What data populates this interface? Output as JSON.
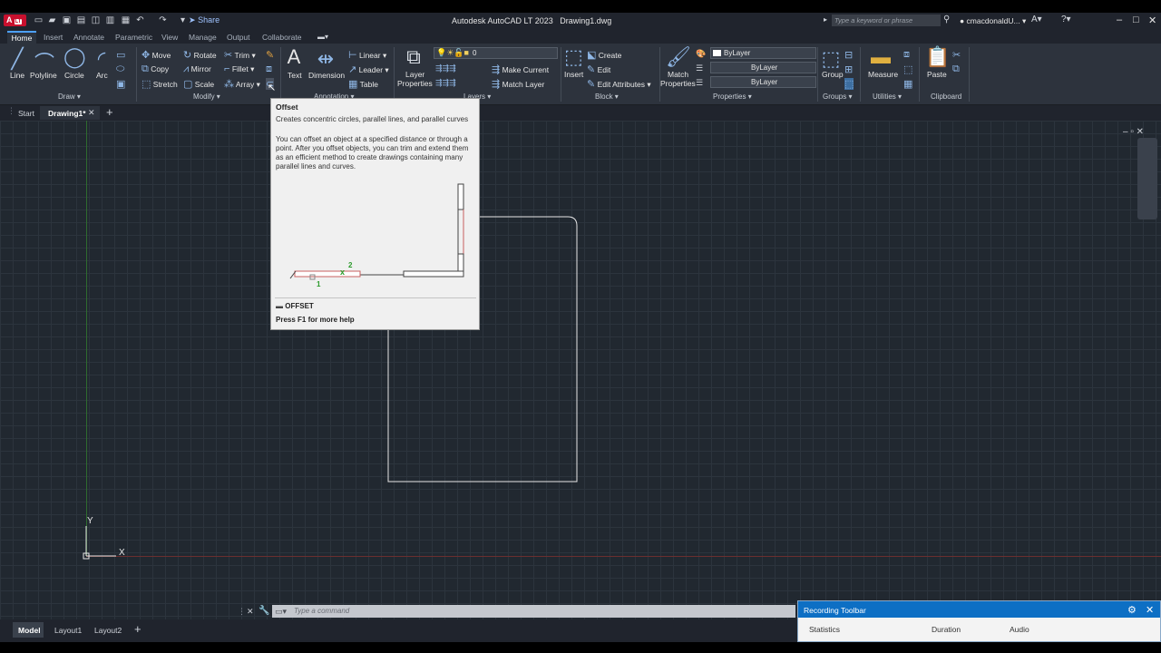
{
  "app": {
    "logo_text": "A",
    "logo_badge": "LT",
    "title": "Autodesk AutoCAD LT 2023",
    "document": "Drawing1.dwg",
    "share_label": "Share",
    "search_placeholder": "Type a keyword or phrase",
    "user": "cmacdonaldU..."
  },
  "ribbon_tabs": [
    "Home",
    "Insert",
    "Annotate",
    "Parametric",
    "View",
    "Manage",
    "Output",
    "Collaborate"
  ],
  "draw": {
    "panel": "Draw",
    "line": "Line",
    "polyline": "Polyline",
    "circle": "Circle",
    "arc": "Arc"
  },
  "modify": {
    "panel": "Modify",
    "move": "Move",
    "rotate": "Rotate",
    "trim": "Trim",
    "copy": "Copy",
    "mirror": "Mirror",
    "fillet": "Fillet",
    "stretch": "Stretch",
    "scale": "Scale",
    "array": "Array"
  },
  "annotation": {
    "panel": "Annotation",
    "text": "Text",
    "dimension": "Dimension",
    "linear": "Linear",
    "leader": "Leader",
    "table": "Table"
  },
  "layers": {
    "panel": "Layers",
    "layer_props_1": "Layer",
    "layer_props_2": "Properties",
    "current_layer": "0",
    "make_current": "Make Current",
    "match_layer": "Match Layer"
  },
  "block": {
    "panel": "Block",
    "insert": "Insert",
    "create": "Create",
    "edit": "Edit",
    "edit_attributes": "Edit Attributes"
  },
  "properties": {
    "panel": "Properties",
    "match_1": "Match",
    "match_2": "Properties",
    "color": "ByLayer",
    "linetype": "ByLayer",
    "lineweight": "ByLayer"
  },
  "groups": {
    "panel": "Groups",
    "group": "Group"
  },
  "utilities": {
    "panel": "Utilities",
    "measure": "Measure"
  },
  "clipboard": {
    "panel": "Clipboard",
    "paste": "Paste"
  },
  "file_tabs": {
    "start": "Start",
    "drawing": "Drawing1*"
  },
  "tooltip": {
    "title": "Offset",
    "summary": "Creates concentric circles, parallel lines, and parallel curves",
    "description": "You can offset an object at a specified distance or through a point. After you offset objects, you can trim and extend them as an efficient method to create drawings containing many parallel lines and curves.",
    "diagram_label_1": "1",
    "diagram_label_2": "2",
    "command": "OFFSET",
    "help": "Press F1 for more help"
  },
  "ucs": {
    "x": "X",
    "y": "Y"
  },
  "command_line": {
    "placeholder": "Type a command"
  },
  "layout_tabs": [
    "Model",
    "Layout1",
    "Layout2"
  ],
  "recording_toolbar": {
    "title": "Recording Toolbar",
    "statistics": "Statistics",
    "duration": "Duration",
    "audio": "Audio"
  }
}
